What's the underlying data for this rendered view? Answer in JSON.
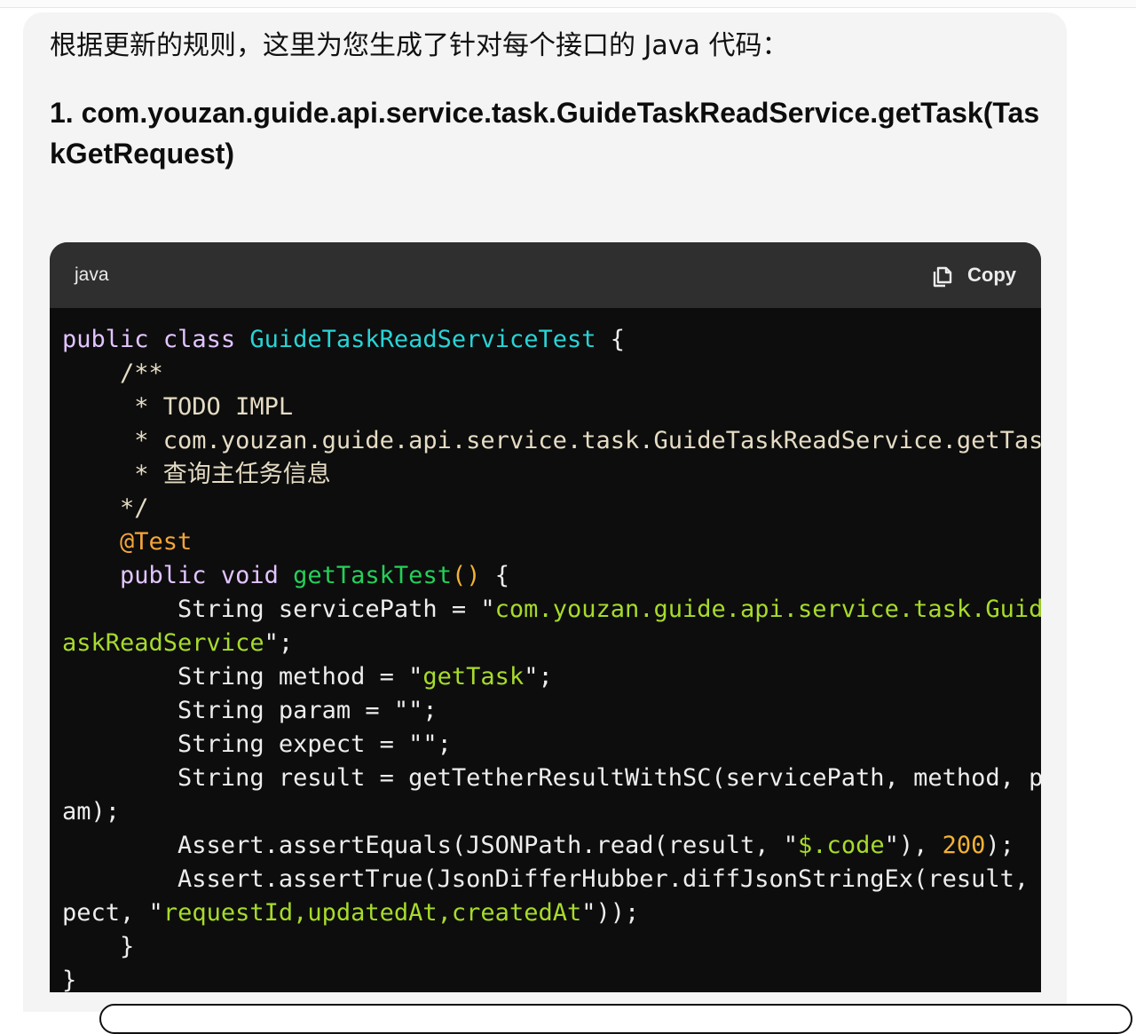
{
  "message": {
    "intro": "根据更新的规则，这里为您生成了针对每个接口的 Java 代码：",
    "heading": "1. com.youzan.guide.api.service.task.GuideTaskReadService.getTask(TaskGetRequest)"
  },
  "code_block": {
    "language": "java",
    "copy_label": "Copy",
    "copy_icon": "clipboard-icon",
    "lines": [
      {
        "t": "public class GuideTaskReadServiceTest {"
      },
      {
        "t": "    /**"
      },
      {
        "t": "     * TODO IMPL"
      },
      {
        "t": "     * com.youzan.guide.api.service.task.GuideTaskReadService.getTask"
      },
      {
        "t": "     * 查询主任务信息"
      },
      {
        "t": "    */"
      },
      {
        "t": "    @Test"
      },
      {
        "t": "    public void getTaskTest() {"
      },
      {
        "t": "        String servicePath = \"com.youzan.guide.api.service.task.GuideT"
      },
      {
        "t": "askReadService\";"
      },
      {
        "t": "        String method = \"getTask\";"
      },
      {
        "t": "        String param = \"\";"
      },
      {
        "t": "        String expect = \"\";"
      },
      {
        "t": "        String result = getTetherResultWithSC(servicePath, method, par"
      },
      {
        "t": "am);"
      },
      {
        "t": "        Assert.assertEquals(JSONPath.read(result, \"$.code\"), 200);"
      },
      {
        "t": "        Assert.assertTrue(JsonDifferHubber.diffJsonStringEx(result, ex"
      },
      {
        "t": "pect, \"requestId,updatedAt,createdAt\"));"
      },
      {
        "t": "    }"
      },
      {
        "t": "}"
      }
    ]
  },
  "colors": {
    "keyword": "#e2c4ff",
    "class_name": "#29d3d6",
    "function": "#24d05a",
    "comment": "#e5dcc4",
    "annotation": "#f4a53a",
    "string": "#a7db2b",
    "number": "#f3b233",
    "code_background": "#0d0d0d",
    "header_background": "#2f2f2f"
  }
}
